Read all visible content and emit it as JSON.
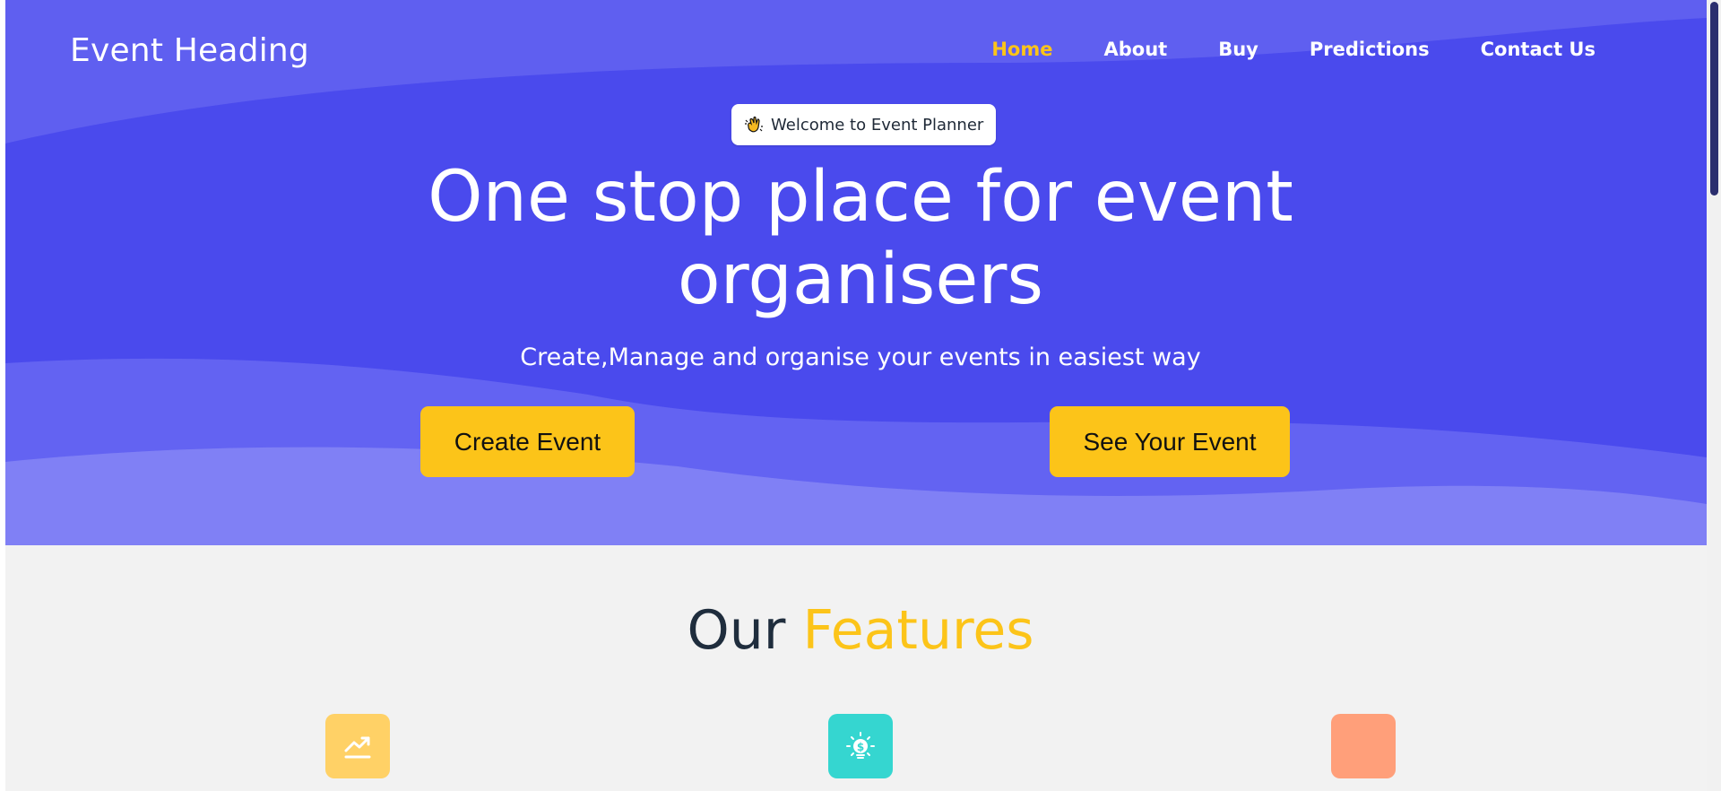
{
  "header": {
    "brand": "Event Heading",
    "nav": [
      {
        "label": "Home",
        "active": true
      },
      {
        "label": "About",
        "active": false
      },
      {
        "label": "Buy",
        "active": false
      },
      {
        "label": "Predictions",
        "active": false
      },
      {
        "label": "Contact Us",
        "active": false
      }
    ]
  },
  "hero": {
    "badge_icon": "waving-hand-icon",
    "badge_text": "Welcome to Event Planner",
    "headline_line1": "One stop place for event",
    "headline_line2": "organisers",
    "subheadline": "Create,Manage and organise your events in easiest way",
    "primary_button": "Create Event",
    "secondary_button": "See Your Event"
  },
  "features": {
    "title_part1": "Our",
    "title_part2": "Features",
    "icons": [
      "trending-up-icon",
      "lightbulb-dollar-icon",
      "blank-icon"
    ]
  },
  "colors": {
    "hero_bg": "#4a4aed",
    "accent": "#fcc419",
    "feature_1": "#ffd166",
    "feature_2": "#35d6d0",
    "feature_3": "#ff9f7a"
  }
}
